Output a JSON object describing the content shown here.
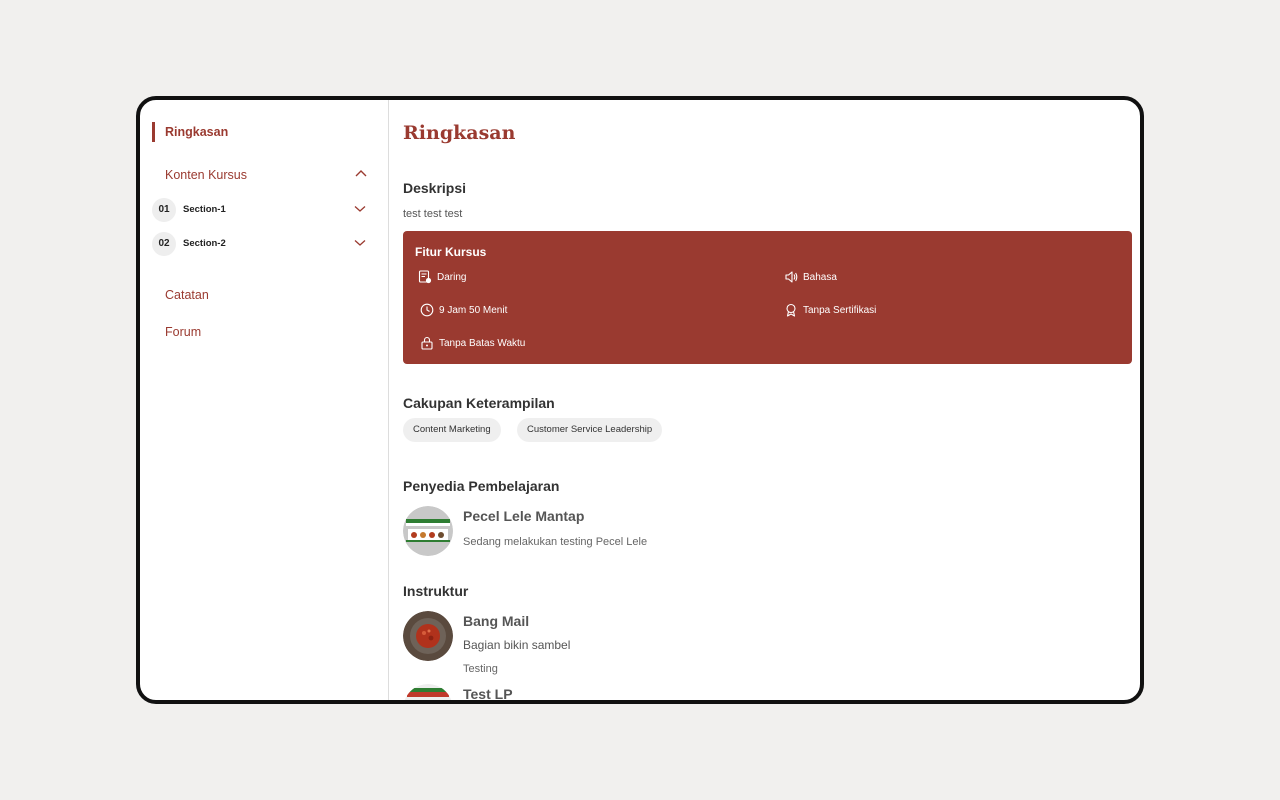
{
  "sidebar": {
    "active": "Ringkasan",
    "content_label": "Konten Kursus",
    "sections": [
      {
        "num": "01",
        "label": "Section-1"
      },
      {
        "num": "02",
        "label": "Section-2"
      }
    ],
    "notes": "Catatan",
    "forum": "Forum"
  },
  "main": {
    "title": "Ringkasan",
    "description_heading": "Deskripsi",
    "description_text": "test test test",
    "features": {
      "title": "Fitur Kursus",
      "items": [
        {
          "icon": "online-icon",
          "label": "Daring"
        },
        {
          "icon": "speaker-icon",
          "label": "Bahasa"
        },
        {
          "icon": "clock-icon",
          "label": "9 Jam 50 Menit"
        },
        {
          "icon": "certificate-icon",
          "label": "Tanpa Sertifikasi"
        },
        {
          "icon": "lock-icon",
          "label": "Tanpa Batas Waktu"
        }
      ]
    },
    "skills_heading": "Cakupan Keterampilan",
    "skills": [
      "Content Marketing",
      "Customer Service Leadership"
    ],
    "provider_heading": "Penyedia Pembelajaran",
    "provider": {
      "name": "Pecel Lele Mantap",
      "description": "Sedang melakukan testing Pecel Lele"
    },
    "instructor_heading": "Instruktur",
    "instructors": [
      {
        "name": "Bang Mail",
        "role": "Bagian bikin sambel",
        "note": "Testing"
      },
      {
        "name": "Test LP"
      }
    ]
  },
  "colors": {
    "accent": "#9a3a30",
    "background": "#f1f0ee",
    "chip": "#efefef"
  }
}
